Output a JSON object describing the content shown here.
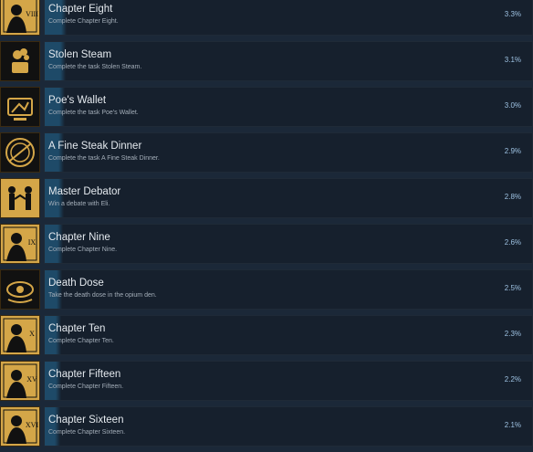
{
  "achievements": [
    {
      "title": "Chapter Eight",
      "desc": "Complete Chapter Eight.",
      "percent": "3.3%",
      "icon": "chapter-eight-icon",
      "progress": 3.3
    },
    {
      "title": "Stolen Steam",
      "desc": "Complete the task Stolen Steam.",
      "percent": "3.1%",
      "icon": "stolen-steam-icon",
      "progress": 3.1
    },
    {
      "title": "Poe's Wallet",
      "desc": "Complete the task Poe's Wallet.",
      "percent": "3.0%",
      "icon": "wallet-icon",
      "progress": 3.0
    },
    {
      "title": "A Fine Steak Dinner",
      "desc": "Complete the task A Fine Steak Dinner.",
      "percent": "2.9%",
      "icon": "steak-plate-icon",
      "progress": 2.9
    },
    {
      "title": "Master Debator",
      "desc": "Win a debate with Eli.",
      "percent": "2.8%",
      "icon": "debate-figures-icon",
      "progress": 2.8
    },
    {
      "title": "Chapter Nine",
      "desc": "Complete Chapter Nine.",
      "percent": "2.6%",
      "icon": "chapter-nine-icon",
      "progress": 2.6
    },
    {
      "title": "Death Dose",
      "desc": "Take the death dose in the opium den.",
      "percent": "2.5%",
      "icon": "opium-eye-icon",
      "progress": 2.5
    },
    {
      "title": "Chapter Ten",
      "desc": "Complete Chapter Ten.",
      "percent": "2.3%",
      "icon": "chapter-ten-icon",
      "progress": 2.3
    },
    {
      "title": "Chapter Fifteen",
      "desc": "Complete Chapter Fifteen.",
      "percent": "2.2%",
      "icon": "chapter-fifteen-icon",
      "progress": 2.2
    },
    {
      "title": "Chapter Sixteen",
      "desc": "Complete Chapter Sixteen.",
      "percent": "2.1%",
      "icon": "chapter-sixteen-icon",
      "progress": 2.1
    }
  ],
  "icon_labels": [
    "VIII",
    "",
    "",
    "",
    "",
    "IX",
    "",
    "X",
    "XV",
    "XVI"
  ],
  "colors": {
    "background": "#1b2838",
    "card": "#16202d",
    "progress_bar": "#1e4a68",
    "percent_text": "#9ec2e2",
    "icon_gold": "#d4a648"
  }
}
